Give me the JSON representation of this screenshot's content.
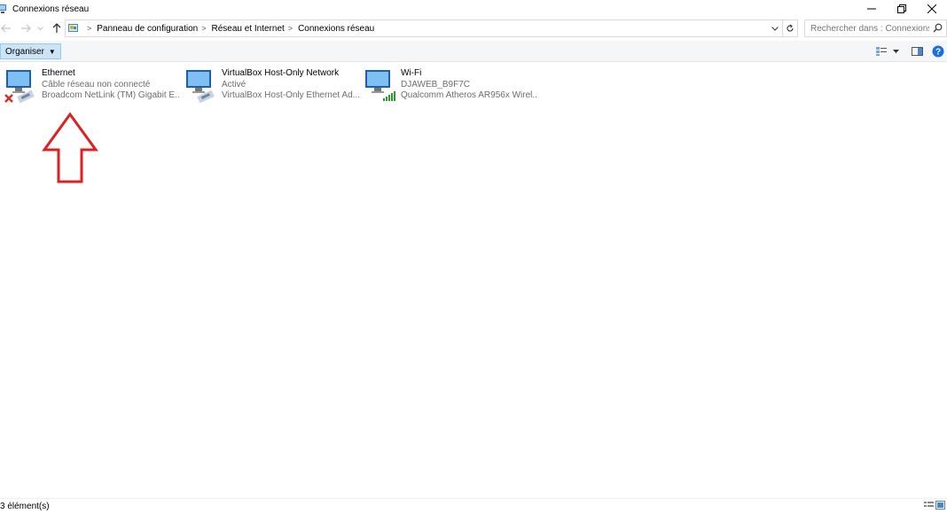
{
  "window": {
    "title": "Connexions réseau",
    "minimize_icon": "minimize-icon",
    "restore_icon": "restore-icon",
    "close_icon": "close-icon"
  },
  "address": {
    "breadcrumbs": [
      "Panneau de configuration",
      "Réseau et Internet",
      "Connexions réseau"
    ],
    "search_placeholder": "Rechercher dans : Connexions..."
  },
  "toolbar": {
    "organize_label": "Organiser"
  },
  "connections": [
    {
      "name": "Ethernet",
      "status": "Câble réseau non connecté",
      "device": "Broadcom NetLink (TM) Gigabit E...",
      "icon": "ethernet-disconnected-icon"
    },
    {
      "name": "VirtualBox Host-Only Network",
      "status": "Activé",
      "device": "VirtualBox Host-Only Ethernet Ad...",
      "icon": "ethernet-adapter-icon"
    },
    {
      "name": "Wi-Fi",
      "status": "DJAWEB_B9F7C",
      "device": "Qualcomm Atheros AR956x Wirel...",
      "icon": "wifi-adapter-icon"
    }
  ],
  "annotation": {
    "icon": "red-up-arrow",
    "color": "#e02020"
  },
  "status": {
    "count": "3 élément(s)"
  },
  "colors": {
    "accent": "#cce4f7",
    "secondary_text": "#6d6d6d",
    "disconnected": "#d32f2f",
    "signal": "#2e9a2e"
  }
}
